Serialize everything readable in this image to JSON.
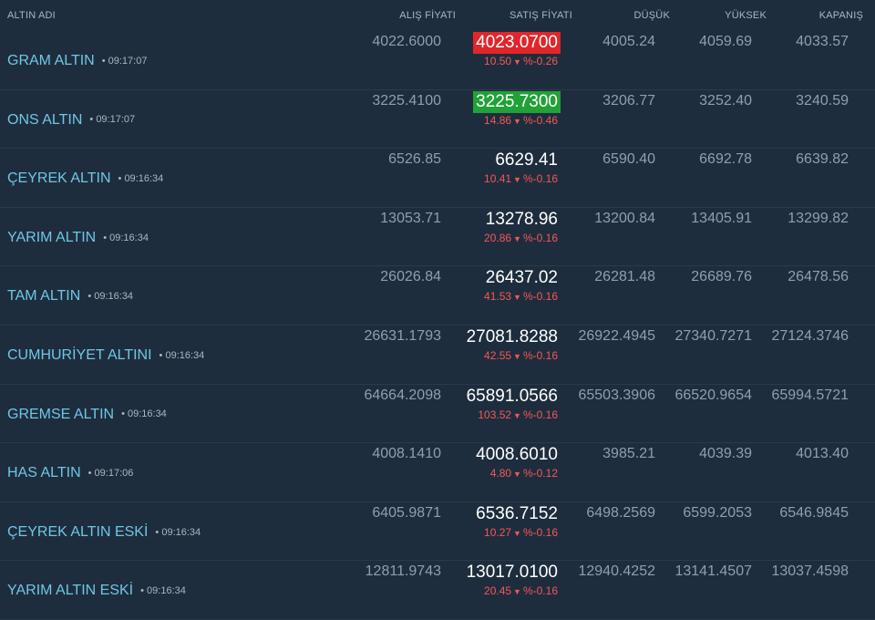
{
  "header": {
    "name": "ALTIN ADI",
    "alis": "ALIŞ FİYATI",
    "satis": "SATIŞ FİYATI",
    "dusuk": "DÜŞÜK",
    "yuksek": "YÜKSEK",
    "kapanis": "KAPANIŞ"
  },
  "colors": {
    "background": "#1e2d3d",
    "name": "#6fc6e6",
    "down": "#f45757",
    "highlight_red": "#e0262a",
    "highlight_green": "#21a136"
  },
  "rows": [
    {
      "name": "GRAM ALTIN",
      "time": "09:17:07",
      "alis": "4022.6000",
      "satis": "4023.0700",
      "highlight": "red",
      "change": "10.50",
      "pct": "%-0.26",
      "dusuk": "4005.24",
      "yuksek": "4059.69",
      "kapanis": "4033.57"
    },
    {
      "name": "ONS ALTIN",
      "time": "09:17:07",
      "alis": "3225.4100",
      "satis": "3225.7300",
      "highlight": "green",
      "change": "14.86",
      "pct": "%-0.46",
      "dusuk": "3206.77",
      "yuksek": "3252.40",
      "kapanis": "3240.59"
    },
    {
      "name": "ÇEYREK ALTIN",
      "time": "09:16:34",
      "alis": "6526.85",
      "satis": "6629.41",
      "highlight": "",
      "change": "10.41",
      "pct": "%-0.16",
      "dusuk": "6590.40",
      "yuksek": "6692.78",
      "kapanis": "6639.82"
    },
    {
      "name": "YARIM ALTIN",
      "time": "09:16:34",
      "alis": "13053.71",
      "satis": "13278.96",
      "highlight": "",
      "change": "20.86",
      "pct": "%-0.16",
      "dusuk": "13200.84",
      "yuksek": "13405.91",
      "kapanis": "13299.82"
    },
    {
      "name": "TAM ALTIN",
      "time": "09:16:34",
      "alis": "26026.84",
      "satis": "26437.02",
      "highlight": "",
      "change": "41.53",
      "pct": "%-0.16",
      "dusuk": "26281.48",
      "yuksek": "26689.76",
      "kapanis": "26478.56"
    },
    {
      "name": "CUMHURİYET ALTINI",
      "time": "09:16:34",
      "alis": "26631.1793",
      "satis": "27081.8288",
      "highlight": "",
      "change": "42.55",
      "pct": "%-0.16",
      "dusuk": "26922.4945",
      "yuksek": "27340.7271",
      "kapanis": "27124.3746"
    },
    {
      "name": "GREMSE ALTIN",
      "time": "09:16:34",
      "alis": "64664.2098",
      "satis": "65891.0566",
      "highlight": "",
      "change": "103.52",
      "pct": "%-0.16",
      "dusuk": "65503.3906",
      "yuksek": "66520.9654",
      "kapanis": "65994.5721"
    },
    {
      "name": "HAS ALTIN",
      "time": "09:17:06",
      "alis": "4008.1410",
      "satis": "4008.6010",
      "highlight": "",
      "change": "4.80",
      "pct": "%-0.12",
      "dusuk": "3985.21",
      "yuksek": "4039.39",
      "kapanis": "4013.40"
    },
    {
      "name": "ÇEYREK ALTIN ESKİ",
      "time": "09:16:34",
      "alis": "6405.9871",
      "satis": "6536.7152",
      "highlight": "",
      "change": "10.27",
      "pct": "%-0.16",
      "dusuk": "6498.2569",
      "yuksek": "6599.2053",
      "kapanis": "6546.9845"
    },
    {
      "name": "YARIM ALTIN ESKİ",
      "time": "09:16:34",
      "alis": "12811.9743",
      "satis": "13017.0100",
      "highlight": "",
      "change": "20.45",
      "pct": "%-0.16",
      "dusuk": "12940.4252",
      "yuksek": "13141.4507",
      "kapanis": "13037.4598"
    }
  ]
}
